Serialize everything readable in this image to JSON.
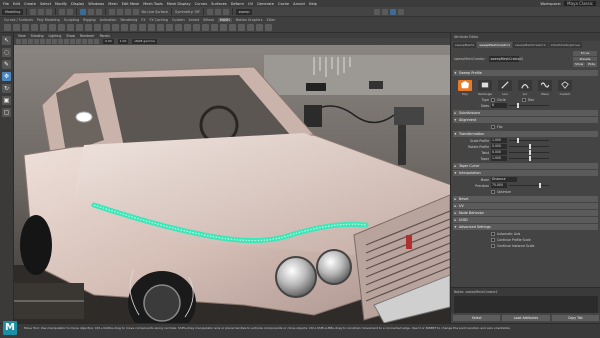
{
  "menubar": {
    "items": [
      "File",
      "Edit",
      "Create",
      "Select",
      "Modify",
      "Display",
      "Windows",
      "Mesh",
      "Edit Mesh",
      "Mesh Tools",
      "Mesh Display",
      "Curves",
      "Surfaces",
      "Deform",
      "UV",
      "Generate",
      "Cache",
      "Arnold",
      "Help"
    ],
    "workspace": "Workspace:",
    "account": "Maya Classic"
  },
  "statusline": {
    "menuset": "Modeling",
    "live_surface": "No Live Surface",
    "symmetry": "Symmetry: Off",
    "search": "sweep"
  },
  "shelf": {
    "tabs": [
      "Curves / Surfaces",
      "Poly Modeling",
      "Sculpting",
      "Rigging",
      "Animation",
      "Rendering",
      "FX",
      "FX Caching",
      "Custom",
      "Arnold",
      "Bifrost",
      "MASH",
      "Motion Graphics",
      "XGen"
    ],
    "active_tab": 11,
    "icon_count": 30
  },
  "toolbox": {
    "tools": [
      "select-tool-icon",
      "lasso-tool-icon",
      "paint-select-icon",
      "move-tool-icon",
      "rotate-tool-icon",
      "scale-tool-icon",
      "last-tool-icon"
    ],
    "active": 3
  },
  "viewport": {
    "menus": [
      "View",
      "Shading",
      "Lighting",
      "Show",
      "Renderer",
      "Panels"
    ],
    "camera": "persp",
    "colorspace": "sRGB gamma",
    "exposure": "0.00",
    "gamma": "1.00"
  },
  "attribute_editor": {
    "top_label": "Attribute Editor",
    "tabs": [
      "sweepMesh1",
      "sweepMeshCreator1",
      "sweepMeshCreator2",
      "initialShadingGroup"
    ],
    "active_tab": 1,
    "node_label": "sweepMeshCreator:",
    "node_name": "sweepMeshCreator1",
    "buttons": [
      "Focus",
      "Presets",
      "Show",
      "Hide"
    ],
    "sweep_profile_title": "Sweep Profile",
    "profiles": [
      {
        "name": "Poly",
        "selected": true
      },
      {
        "name": "Rectangle",
        "selected": false
      },
      {
        "name": "Line",
        "selected": false
      },
      {
        "name": "Arc",
        "selected": false
      },
      {
        "name": "Wave",
        "selected": false
      },
      {
        "name": "Custom",
        "selected": false
      }
    ],
    "type_label": "Type",
    "type_options": [
      "Circle",
      "Star"
    ],
    "sides_label": "Sides",
    "sides_value": "8",
    "sections_collapsed_1": [
      "Subdivisions",
      "Alignment"
    ],
    "flip_label": "Flip",
    "transformation_title": "Transformation",
    "transform_rows": [
      {
        "label": "Scale Profile",
        "value": "1.000",
        "knob": 0.2
      },
      {
        "label": "Rotate Profile",
        "value": "0.000",
        "knob": 0.5
      },
      {
        "label": "Twist",
        "value": "0.000",
        "knob": 0.5
      },
      {
        "label": "Taper",
        "value": "1.000",
        "knob": 0.5
      }
    ],
    "taper_curve_title": "Taper Curve",
    "interpolation_title": "Interpolation",
    "mode_label": "Mode",
    "mode_value": "Distance",
    "precision_label": "Precision",
    "precision_value": "75.000",
    "precision_fraction": 0.75,
    "optimize_label": "Optimize",
    "sections_collapsed_2": [
      "Bevel",
      "UV",
      "Node Behavior",
      "UUID"
    ],
    "advanced_title": "Advanced Settings",
    "advanced_options": [
      "Automatic Axis",
      "Continue Profile Scale",
      "Continue Instance Scale"
    ],
    "notes_label": "Notes:  sweepMeshCreator1",
    "bottom_buttons": [
      "Select",
      "Load Attributes",
      "Copy Tab"
    ]
  },
  "helpline": {
    "text": "Move Tool: Use manipulator to move object(s). Ctrl+middle-drag to move components along normals. Shift+drag manipulator axis or plane handles to extrude components or clone objects. Ctrl+Shift+LMB+drag to constrain movement to a connected edge. Use D or INSERT to change the pivot position and axis orientation."
  },
  "colors": {
    "accent_blue": "#4a87c0",
    "profile_selected": "#e87a2a",
    "sweep_cyan": "#3fe6b8",
    "car_body": "#d9c4bc",
    "maya_logo": "#1b8fa3"
  }
}
